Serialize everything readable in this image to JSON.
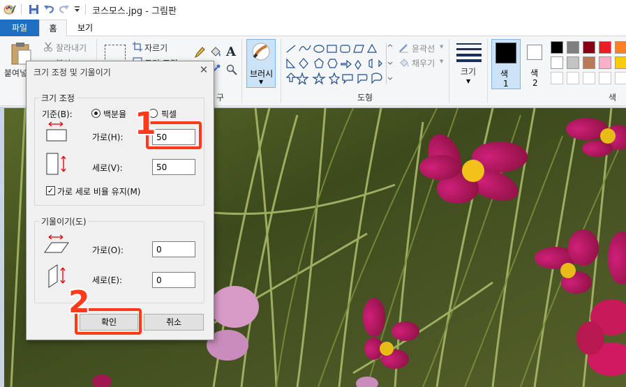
{
  "window": {
    "title": "코스모스.jpg - 그림판"
  },
  "tabs": {
    "file": "파일",
    "home": "홈",
    "view": "보기"
  },
  "ribbon": {
    "clipboard": {
      "paste": "붙여넣",
      "cut": "잘라내기",
      "copy": "복사"
    },
    "image": {
      "crop": "자르기",
      "resize": "크기 조정"
    },
    "tools_label_fragment": "구",
    "brushes": "브러시",
    "shapes": {
      "outline": "윤곽선",
      "fill": "채우기",
      "group_label": "도형"
    },
    "size": "크기",
    "color1": {
      "label": "색",
      "num": "1"
    },
    "color2": {
      "label": "색",
      "num": "2"
    },
    "colors_group_label": "색",
    "palette": [
      "#000000",
      "#7f7f7f",
      "#880015",
      "#ed1c24",
      "#ff7f27",
      "#ffffff",
      "#c3c3c3",
      "#b97a57",
      "#ffaec9",
      "#ffc90e"
    ]
  },
  "dialog": {
    "title": "크기 조정 및 기울이기",
    "resize_group": "크기 조정",
    "basis_label": "기준(B):",
    "percent_option": "백분율",
    "pixel_option": "픽셀",
    "horizontal_label": "가로(H):",
    "horizontal_value": "50",
    "vertical_label": "세로(V):",
    "vertical_value": "50",
    "keep_ratio_label": "가로 세로 비율 유지(M)",
    "keep_ratio_checked": true,
    "skew_group": "기울이기(도)",
    "skew_horizontal_label": "가로(O):",
    "skew_horizontal_value": "0",
    "skew_vertical_label": "세로(E):",
    "skew_vertical_value": "0",
    "ok_button": "확인",
    "cancel_button": "취소"
  },
  "annotations": {
    "step1": "1",
    "step2": "2",
    "color": "#ff3a1a"
  }
}
